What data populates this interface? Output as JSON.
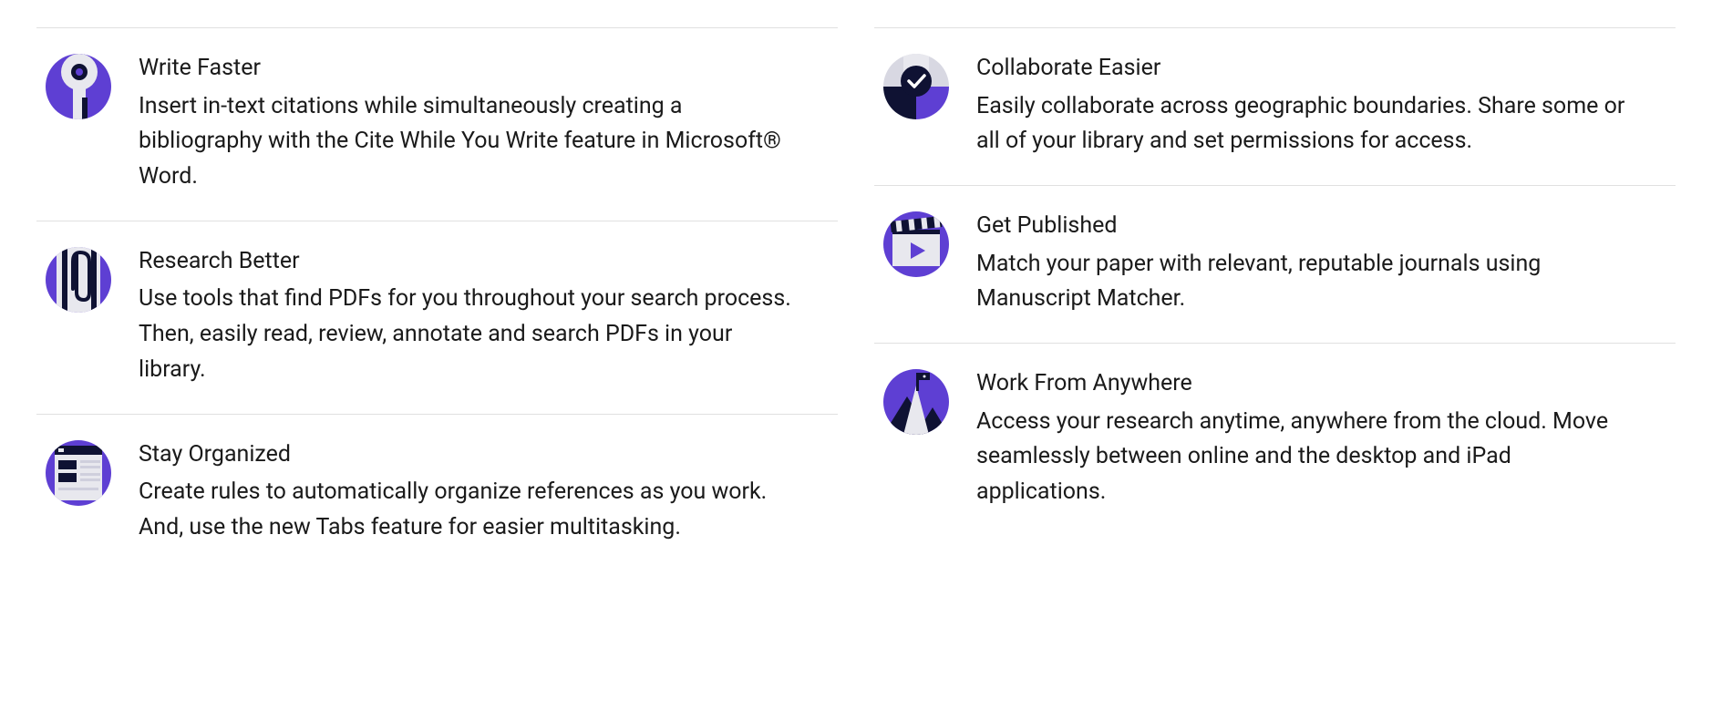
{
  "left": [
    {
      "iconName": "magnifier-icon",
      "title": "Write Faster",
      "desc": "Insert in-text citations while simultaneously creating a bibliography with the Cite While You Write feature in Microsoft® Word."
    },
    {
      "iconName": "paperclip-icon",
      "title": "Research Better",
      "desc": "Use tools that find PDFs for you throughout your search process. Then, easily read, review, annotate and search PDFs in your library."
    },
    {
      "iconName": "tabs-icon",
      "title": "Stay Organized",
      "desc": "Create rules to automatically organize references as you work. And, use the new Tabs feature for easier multitasking."
    }
  ],
  "right": [
    {
      "iconName": "checkmark-icon",
      "title": "Collaborate Easier",
      "desc": "Easily collaborate across geographic boundaries. Share some or all of your library and set permissions for access."
    },
    {
      "iconName": "clapperboard-icon",
      "title": "Get Published",
      "desc": "Match your paper with relevant, reputable journals using Manuscript Matcher."
    },
    {
      "iconName": "mountain-icon",
      "title": "Work From Anywhere",
      "desc": "Access your research anytime, anywhere from the cloud. Move seamlessly between online and the desktop and iPad applications."
    }
  ]
}
